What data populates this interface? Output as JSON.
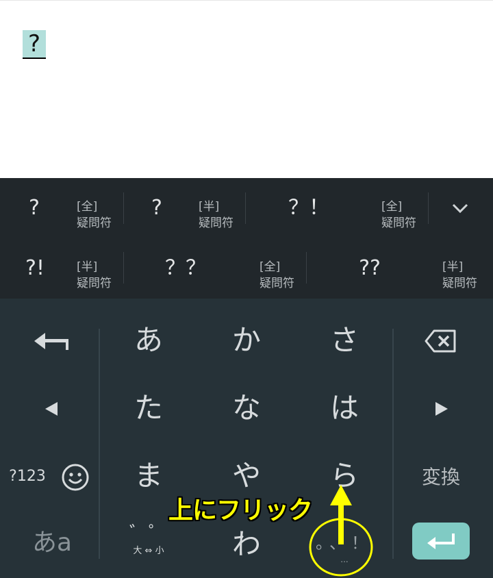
{
  "editor": {
    "composing_text": "?"
  },
  "candidates": {
    "row1": [
      {
        "main": "?",
        "sub_top": "[全]",
        "sub_bottom": "疑問符"
      },
      {
        "main": "?",
        "sub_top": "[半]",
        "sub_bottom": "疑問符"
      },
      {
        "main": "？！",
        "sub_top": "[全]",
        "sub_bottom": "疑問符"
      }
    ],
    "row2": [
      {
        "main": "?!",
        "sub_top": "[半]",
        "sub_bottom": "疑問符"
      },
      {
        "main": "？？",
        "sub_top": "[全]",
        "sub_bottom": "疑問符"
      },
      {
        "main": "??",
        "sub_top": "[半]",
        "sub_bottom": "疑問符"
      }
    ],
    "collapse_icon": "chevron-down-icon"
  },
  "keyboard": {
    "rows": [
      [
        "あ",
        "か",
        "さ"
      ],
      [
        "た",
        "な",
        "は"
      ],
      [
        "ま",
        "や",
        "ら"
      ]
    ],
    "wa": "わ",
    "symbols_key": "?123",
    "convert_key": "変換",
    "kana_toggle": "あa",
    "dakuten_key": {
      "top": "゛゜",
      "bottom": "大 ⇔ 小"
    },
    "punct_key": "。、！",
    "more_dots": "...",
    "icons": [
      "undo-arrow-icon",
      "backspace-icon",
      "left-arrow-icon",
      "right-arrow-icon",
      "emoji-icon",
      "enter-icon"
    ]
  },
  "annotation": {
    "text": "上にフリック",
    "color": "#ffff00"
  },
  "colors": {
    "keyboard_bg": "#263238",
    "candidate_bg": "#21272b",
    "enter_bg": "#80cbc4",
    "highlight": "#b2dfdb"
  }
}
